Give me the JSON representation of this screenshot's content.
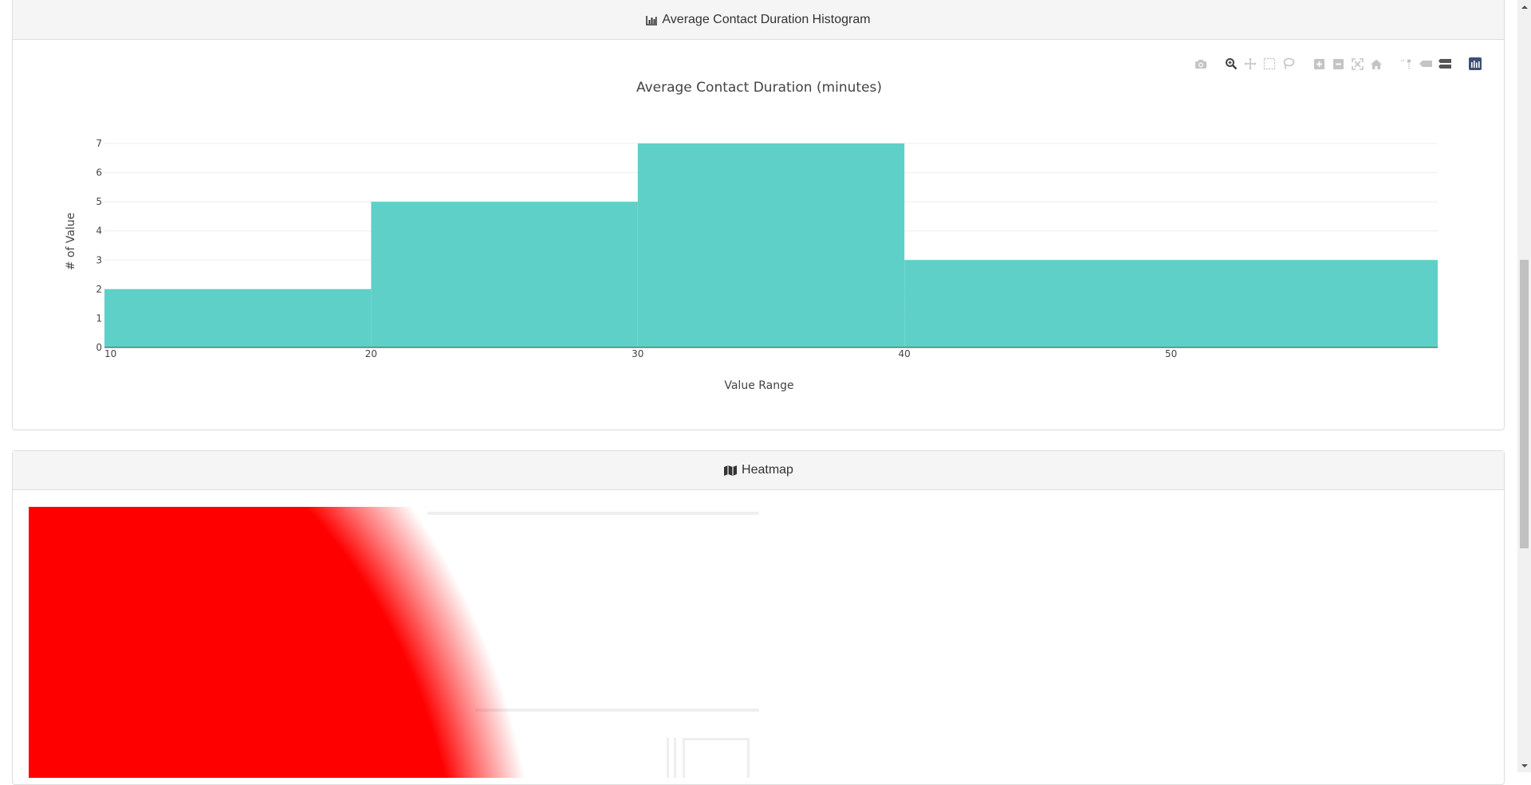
{
  "histogram_panel": {
    "title": "Average Contact Duration Histogram",
    "icon": "bar-chart-icon"
  },
  "heatmap_panel": {
    "title": "Heatmap",
    "icon": "map-icon",
    "blob_color": "#ff0000"
  },
  "modebar": {
    "buttons": [
      "camera-icon",
      "zoom-icon",
      "pan-icon",
      "box-select-icon",
      "lasso-select-icon",
      "zoom-in-icon",
      "zoom-out-icon",
      "autoscale-icon",
      "reset-axes-icon",
      "spike-lines-icon",
      "hover-closest-icon",
      "hover-compare-icon",
      "plotly-logo-icon"
    ]
  },
  "chart_data": {
    "type": "histogram",
    "title": "Average Contact Duration (minutes)",
    "xlabel": "Value Range",
    "ylabel": "# of Value",
    "bins": [
      {
        "start": 10,
        "end": 20,
        "count": 2
      },
      {
        "start": 20,
        "end": 30,
        "count": 5
      },
      {
        "start": 30,
        "end": 40,
        "count": 7
      },
      {
        "start": 40,
        "end": 60,
        "count": 3
      }
    ],
    "xlim": [
      10,
      60
    ],
    "ylim": [
      0,
      7
    ],
    "x_ticks": [
      "10",
      "20",
      "30",
      "40",
      "50"
    ],
    "x_tick_values": [
      10,
      20,
      30,
      40,
      50
    ],
    "y_ticks": [
      "0",
      "1",
      "2",
      "3",
      "4",
      "5",
      "6",
      "7"
    ],
    "y_tick_values": [
      0,
      1,
      2,
      3,
      4,
      5,
      6,
      7
    ],
    "bar_color": "#5fd0c8",
    "grid": true
  }
}
